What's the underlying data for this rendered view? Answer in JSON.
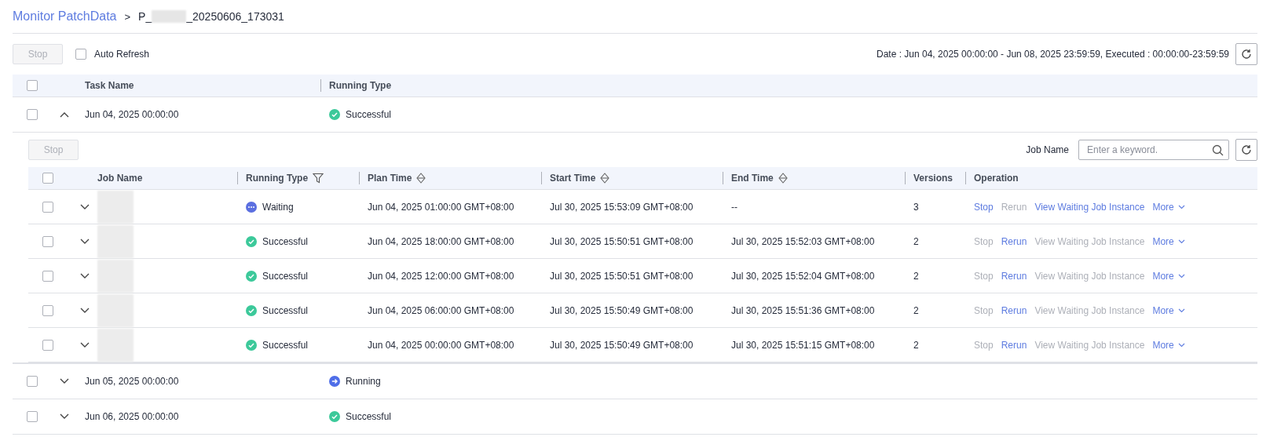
{
  "breadcrumb": {
    "parent": "Monitor PatchData",
    "separator": ">",
    "current_prefix": "P_",
    "current_suffix": "_20250606_173031"
  },
  "toolbar": {
    "stop_button": {
      "label": "Stop",
      "disabled": true
    },
    "auto_refresh": {
      "label": "Auto Refresh",
      "checked": false
    },
    "date_range": "Date : Jun 04, 2025 00:00:00 - Jun 08, 2025 23:59:59, Executed : 00:00:00-23:59:59"
  },
  "task_table": {
    "columns": [
      "Task Name",
      "Running Type"
    ],
    "header_checked": false,
    "rows": [
      {
        "name": "Jun 04, 2025 00:00:00",
        "status": {
          "label": "Successful",
          "kind": "successful"
        },
        "checked": false,
        "expanded": true
      },
      {
        "name": "Jun 05, 2025 00:00:00",
        "status": {
          "label": "Running",
          "kind": "running"
        },
        "checked": false,
        "expanded": false
      },
      {
        "name": "Jun 06, 2025 00:00:00",
        "status": {
          "label": "Successful",
          "kind": "successful"
        },
        "checked": false,
        "expanded": false
      }
    ]
  },
  "job_panel": {
    "stop_button": {
      "label": "Stop",
      "disabled": true
    },
    "search_label": "Job Name",
    "search": {
      "placeholder": "Enter a keyword."
    },
    "columns": [
      "Job Name",
      "Running Type",
      "Plan Time",
      "Start Time",
      "End Time",
      "Versions",
      "Operation"
    ],
    "header_checked": false,
    "rows": [
      {
        "status": {
          "label": "Waiting",
          "kind": "waiting"
        },
        "plan_time": "Jun 04, 2025 01:00:00 GMT+08:00",
        "start_time": "Jul 30, 2025 15:53:09 GMT+08:00",
        "end_time": "--",
        "versions": "3",
        "checked": false,
        "expanded": false,
        "actions": [
          {
            "label": "Stop",
            "disabled": false
          },
          {
            "label": "Rerun",
            "disabled": true
          },
          {
            "label": "View Waiting Job Instance",
            "disabled": false
          },
          {
            "label": "More",
            "disabled": false
          }
        ]
      },
      {
        "status": {
          "label": "Successful",
          "kind": "successful"
        },
        "plan_time": "Jun 04, 2025 18:00:00 GMT+08:00",
        "start_time": "Jul 30, 2025 15:50:51 GMT+08:00",
        "end_time": "Jul 30, 2025 15:52:03 GMT+08:00",
        "versions": "2",
        "checked": false,
        "expanded": false,
        "actions": [
          {
            "label": "Stop",
            "disabled": true
          },
          {
            "label": "Rerun",
            "disabled": false
          },
          {
            "label": "View Waiting Job Instance",
            "disabled": true
          },
          {
            "label": "More",
            "disabled": false
          }
        ]
      },
      {
        "status": {
          "label": "Successful",
          "kind": "successful"
        },
        "plan_time": "Jun 04, 2025 12:00:00 GMT+08:00",
        "start_time": "Jul 30, 2025 15:50:51 GMT+08:00",
        "end_time": "Jul 30, 2025 15:52:04 GMT+08:00",
        "versions": "2",
        "checked": false,
        "expanded": false,
        "actions": [
          {
            "label": "Stop",
            "disabled": true
          },
          {
            "label": "Rerun",
            "disabled": false
          },
          {
            "label": "View Waiting Job Instance",
            "disabled": true
          },
          {
            "label": "More",
            "disabled": false
          }
        ]
      },
      {
        "status": {
          "label": "Successful",
          "kind": "successful"
        },
        "plan_time": "Jun 04, 2025 06:00:00 GMT+08:00",
        "start_time": "Jul 30, 2025 15:50:49 GMT+08:00",
        "end_time": "Jul 30, 2025 15:51:36 GMT+08:00",
        "versions": "2",
        "checked": false,
        "expanded": false,
        "actions": [
          {
            "label": "Stop",
            "disabled": true
          },
          {
            "label": "Rerun",
            "disabled": false
          },
          {
            "label": "View Waiting Job Instance",
            "disabled": true
          },
          {
            "label": "More",
            "disabled": false
          }
        ]
      },
      {
        "status": {
          "label": "Successful",
          "kind": "successful"
        },
        "plan_time": "Jun 04, 2025 00:00:00 GMT+08:00",
        "start_time": "Jul 30, 2025 15:50:49 GMT+08:00",
        "end_time": "Jul 30, 2025 15:51:15 GMT+08:00",
        "versions": "2",
        "checked": false,
        "expanded": false,
        "actions": [
          {
            "label": "Stop",
            "disabled": true
          },
          {
            "label": "Rerun",
            "disabled": false
          },
          {
            "label": "View Waiting Job Instance",
            "disabled": true
          },
          {
            "label": "More",
            "disabled": false
          }
        ]
      }
    ]
  }
}
